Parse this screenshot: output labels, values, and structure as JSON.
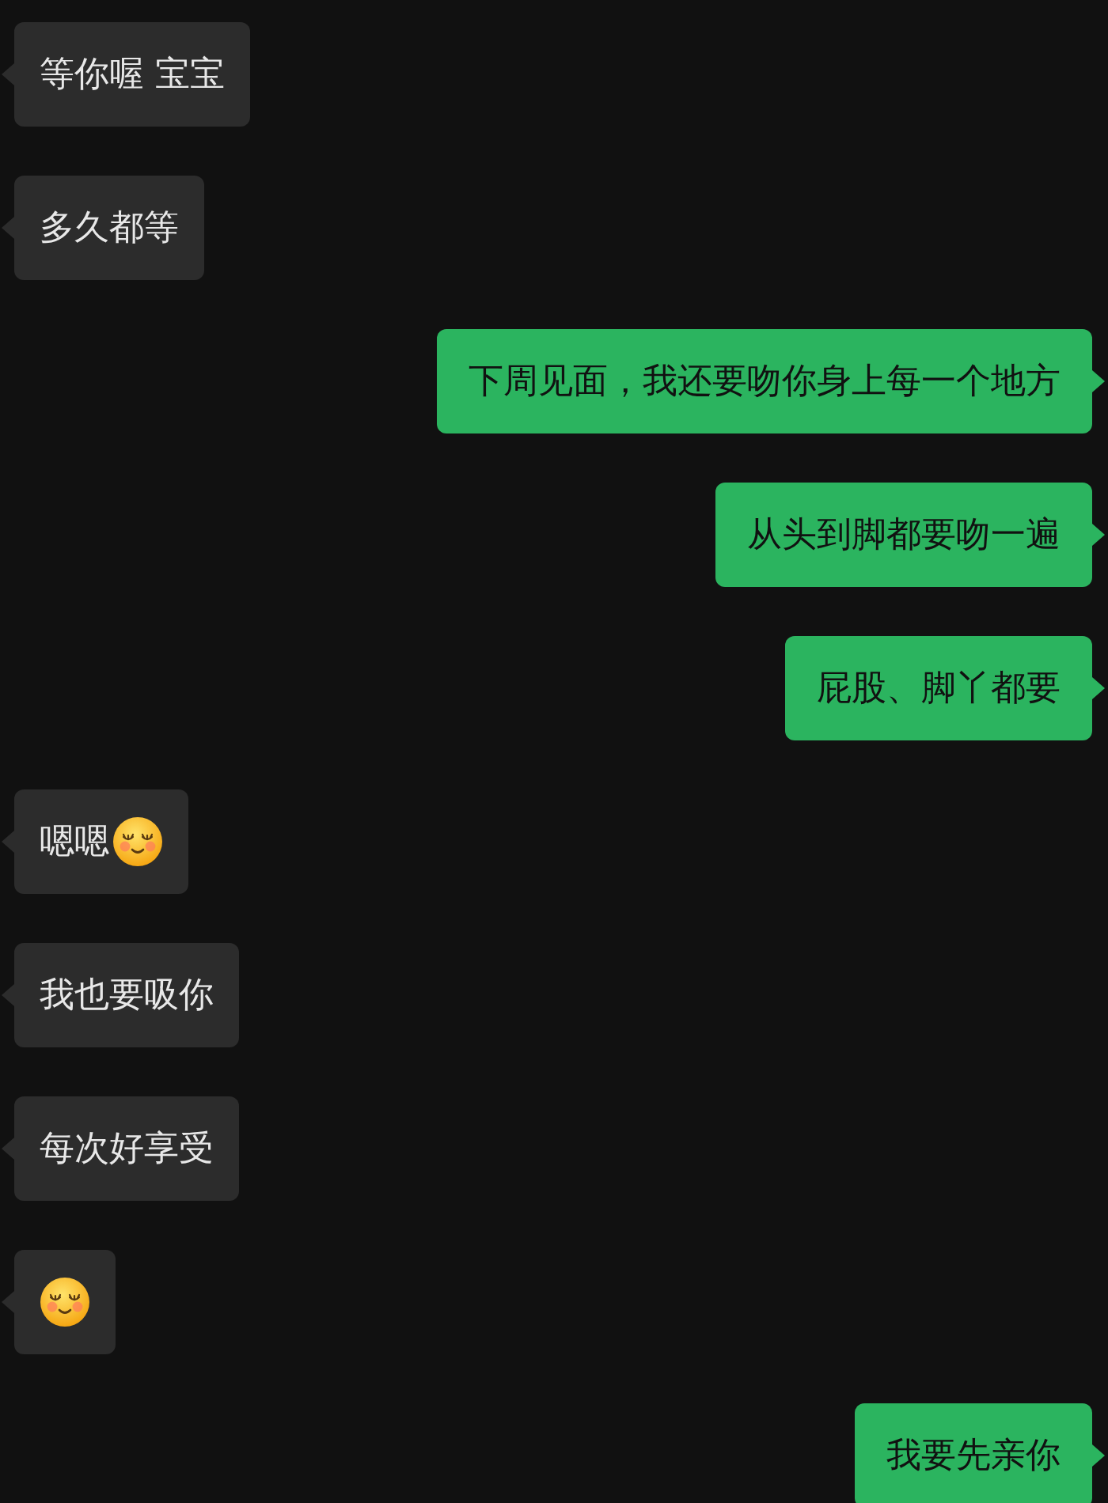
{
  "messages": [
    {
      "kind": "incoming",
      "text": "等你喔 宝宝"
    },
    {
      "kind": "incoming",
      "text": "多久都等"
    },
    {
      "kind": "outgoing",
      "text": "下周见面，我还要吻你身上每一个地方"
    },
    {
      "kind": "outgoing",
      "text": "从头到脚都要吻一遍"
    },
    {
      "kind": "outgoing",
      "text": "屁股、脚丫都要"
    },
    {
      "kind": "incoming",
      "text": "嗯嗯",
      "emoji": true
    },
    {
      "kind": "incoming",
      "text": "我也要吸你"
    },
    {
      "kind": "incoming",
      "text": "每次好享受"
    },
    {
      "kind": "incoming",
      "emoji": true
    },
    {
      "kind": "outgoing",
      "text": "我要先亲你"
    }
  ]
}
